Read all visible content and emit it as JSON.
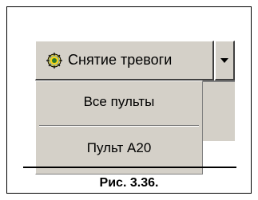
{
  "toolbar": {
    "alarm_reset_label": "Снятие тревоги",
    "icon": "alarm-bell-icon"
  },
  "menu": {
    "items": [
      {
        "label": "Все пульты"
      },
      {
        "label": "Пульт А20"
      }
    ]
  },
  "figure": {
    "caption": "Рис. 3.36."
  },
  "colors": {
    "window_face": "#d4d0c8",
    "shadow": "#808080",
    "dark_shadow": "#404040",
    "highlight": "#ffffff",
    "frame": "#000000"
  }
}
